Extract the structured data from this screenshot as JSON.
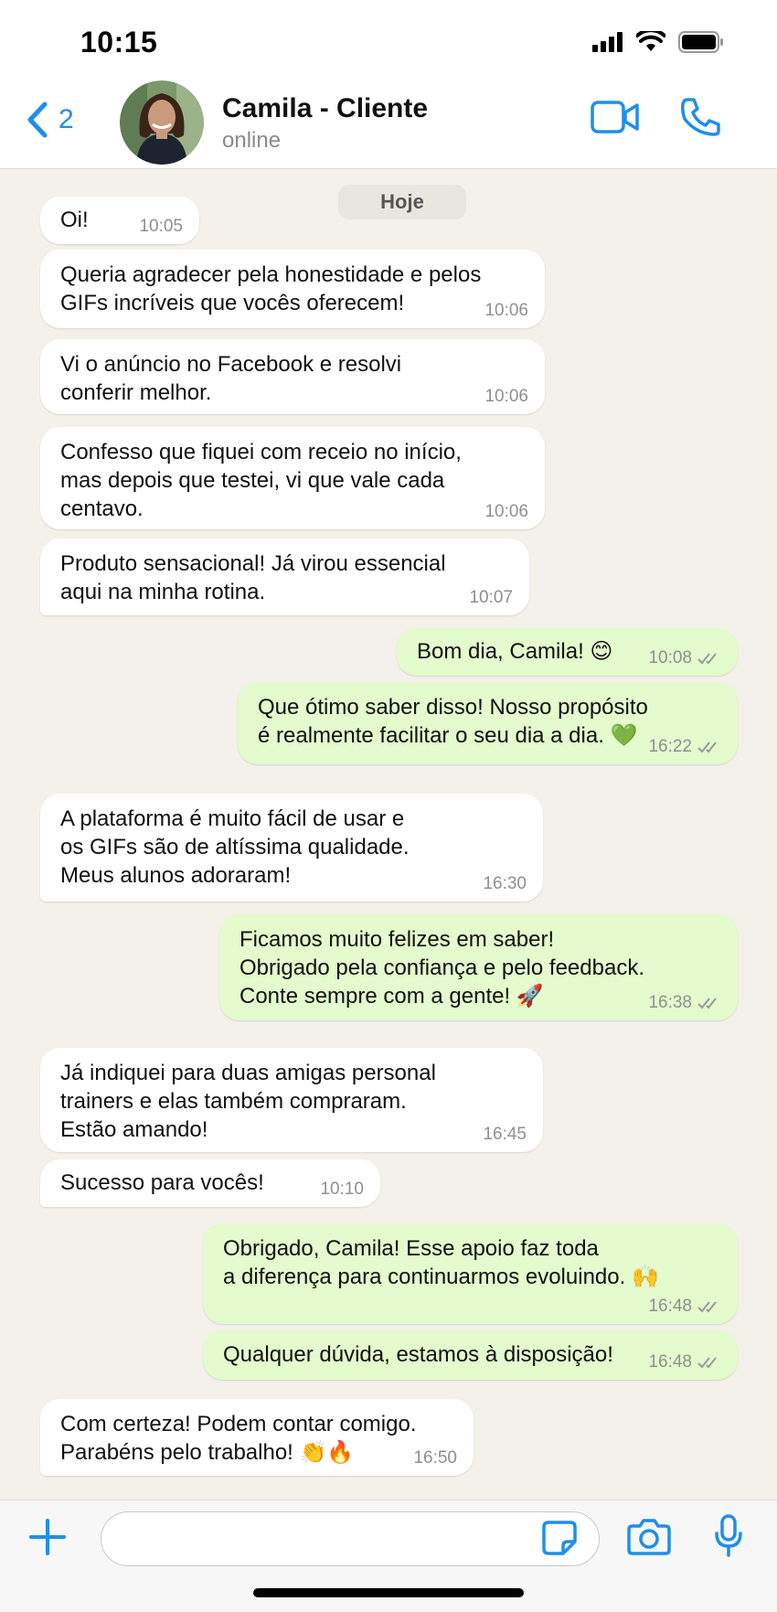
{
  "status_bar": {
    "time": "10:15"
  },
  "header": {
    "back_count": "2",
    "contact_name": "Camila - Cliente",
    "contact_status": "online"
  },
  "chat": {
    "date_label": "Hoje",
    "messages": [
      {
        "dir": "in",
        "text": "Oi!",
        "time": "10:05"
      },
      {
        "dir": "in",
        "text": "Queria agradecer pela honestidade e pelos\nGIFs incríveis que vocês oferecem!",
        "time": "10:06"
      },
      {
        "dir": "in",
        "text": "Vi o anúncio no Facebook e resolvi\nconferir melhor.",
        "time": "10:06"
      },
      {
        "dir": "in",
        "text": "Confesso que fiquei com receio no início,\nmas depois que testei, vi que vale cada\ncentavo.",
        "time": "10:06"
      },
      {
        "dir": "in",
        "text": "Produto sensacional! Já virou essencial\naqui na minha rotina.",
        "time": "10:07"
      },
      {
        "dir": "out",
        "text": "Bom dia, Camila! 😊",
        "time": "10:08"
      },
      {
        "dir": "out",
        "text": "Que ótimo saber disso! Nosso propósito\né realmente facilitar o seu dia a dia. 💚",
        "time": "16:22"
      },
      {
        "dir": "in",
        "text": "A plataforma é muito fácil de usar e\nos GIFs são de altíssima qualidade.\nMeus alunos adoraram!",
        "time": "16:30"
      },
      {
        "dir": "out",
        "text": "Ficamos muito felizes em saber!\nObrigado pela confiança e pelo feedback.\nConte sempre com a gente! 🚀",
        "time": "16:38"
      },
      {
        "dir": "in",
        "text": "Já indiquei para duas amigas personal\ntrainers e elas também compraram.\nEstão amando!",
        "time": "16:45"
      },
      {
        "dir": "in",
        "text": "Sucesso para vocês!",
        "time": "10:10"
      },
      {
        "dir": "out",
        "text": "Obrigado, Camila! Esse apoio faz toda\na diferença para continuarmos evoluindo. 🙌",
        "time": "16:48"
      },
      {
        "dir": "out",
        "text": "Qualquer dúvida, estamos à disposição!",
        "time": "16:48"
      },
      {
        "dir": "in",
        "text": "Com certeza! Podem contar comigo.\nParabéns pelo trabalho! 👏🔥",
        "time": "16:50"
      }
    ]
  },
  "composer": {
    "input_value": "",
    "input_placeholder": ""
  },
  "colors": {
    "accent": "#1f8ee9",
    "incoming_bubble": "#ffffff",
    "outgoing_bubble": "#e3fbcd",
    "chat_background": "#f4f1ea"
  },
  "icons": [
    "back-chevron-icon",
    "video-call-icon",
    "phone-call-icon",
    "plus-icon",
    "sticker-icon",
    "camera-icon",
    "microphone-icon",
    "signal-icon",
    "wifi-icon",
    "battery-icon"
  ]
}
